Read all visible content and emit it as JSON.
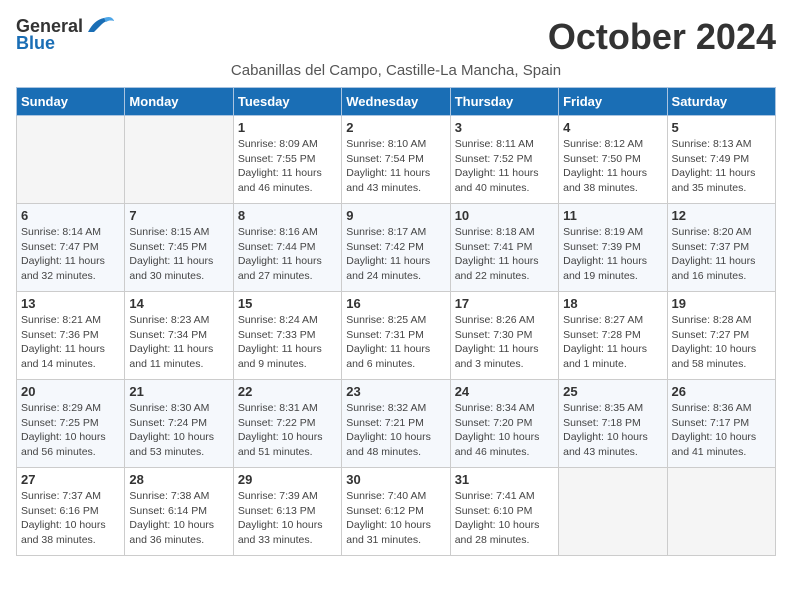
{
  "header": {
    "logo_general": "General",
    "logo_blue": "Blue",
    "month_title": "October 2024",
    "location": "Cabanillas del Campo, Castille-La Mancha, Spain"
  },
  "weekdays": [
    "Sunday",
    "Monday",
    "Tuesday",
    "Wednesday",
    "Thursday",
    "Friday",
    "Saturday"
  ],
  "weeks": [
    [
      {
        "day": "",
        "sunrise": "",
        "sunset": "",
        "daylight": ""
      },
      {
        "day": "",
        "sunrise": "",
        "sunset": "",
        "daylight": ""
      },
      {
        "day": "1",
        "sunrise": "Sunrise: 8:09 AM",
        "sunset": "Sunset: 7:55 PM",
        "daylight": "Daylight: 11 hours and 46 minutes."
      },
      {
        "day": "2",
        "sunrise": "Sunrise: 8:10 AM",
        "sunset": "Sunset: 7:54 PM",
        "daylight": "Daylight: 11 hours and 43 minutes."
      },
      {
        "day": "3",
        "sunrise": "Sunrise: 8:11 AM",
        "sunset": "Sunset: 7:52 PM",
        "daylight": "Daylight: 11 hours and 40 minutes."
      },
      {
        "day": "4",
        "sunrise": "Sunrise: 8:12 AM",
        "sunset": "Sunset: 7:50 PM",
        "daylight": "Daylight: 11 hours and 38 minutes."
      },
      {
        "day": "5",
        "sunrise": "Sunrise: 8:13 AM",
        "sunset": "Sunset: 7:49 PM",
        "daylight": "Daylight: 11 hours and 35 minutes."
      }
    ],
    [
      {
        "day": "6",
        "sunrise": "Sunrise: 8:14 AM",
        "sunset": "Sunset: 7:47 PM",
        "daylight": "Daylight: 11 hours and 32 minutes."
      },
      {
        "day": "7",
        "sunrise": "Sunrise: 8:15 AM",
        "sunset": "Sunset: 7:45 PM",
        "daylight": "Daylight: 11 hours and 30 minutes."
      },
      {
        "day": "8",
        "sunrise": "Sunrise: 8:16 AM",
        "sunset": "Sunset: 7:44 PM",
        "daylight": "Daylight: 11 hours and 27 minutes."
      },
      {
        "day": "9",
        "sunrise": "Sunrise: 8:17 AM",
        "sunset": "Sunset: 7:42 PM",
        "daylight": "Daylight: 11 hours and 24 minutes."
      },
      {
        "day": "10",
        "sunrise": "Sunrise: 8:18 AM",
        "sunset": "Sunset: 7:41 PM",
        "daylight": "Daylight: 11 hours and 22 minutes."
      },
      {
        "day": "11",
        "sunrise": "Sunrise: 8:19 AM",
        "sunset": "Sunset: 7:39 PM",
        "daylight": "Daylight: 11 hours and 19 minutes."
      },
      {
        "day": "12",
        "sunrise": "Sunrise: 8:20 AM",
        "sunset": "Sunset: 7:37 PM",
        "daylight": "Daylight: 11 hours and 16 minutes."
      }
    ],
    [
      {
        "day": "13",
        "sunrise": "Sunrise: 8:21 AM",
        "sunset": "Sunset: 7:36 PM",
        "daylight": "Daylight: 11 hours and 14 minutes."
      },
      {
        "day": "14",
        "sunrise": "Sunrise: 8:23 AM",
        "sunset": "Sunset: 7:34 PM",
        "daylight": "Daylight: 11 hours and 11 minutes."
      },
      {
        "day": "15",
        "sunrise": "Sunrise: 8:24 AM",
        "sunset": "Sunset: 7:33 PM",
        "daylight": "Daylight: 11 hours and 9 minutes."
      },
      {
        "day": "16",
        "sunrise": "Sunrise: 8:25 AM",
        "sunset": "Sunset: 7:31 PM",
        "daylight": "Daylight: 11 hours and 6 minutes."
      },
      {
        "day": "17",
        "sunrise": "Sunrise: 8:26 AM",
        "sunset": "Sunset: 7:30 PM",
        "daylight": "Daylight: 11 hours and 3 minutes."
      },
      {
        "day": "18",
        "sunrise": "Sunrise: 8:27 AM",
        "sunset": "Sunset: 7:28 PM",
        "daylight": "Daylight: 11 hours and 1 minute."
      },
      {
        "day": "19",
        "sunrise": "Sunrise: 8:28 AM",
        "sunset": "Sunset: 7:27 PM",
        "daylight": "Daylight: 10 hours and 58 minutes."
      }
    ],
    [
      {
        "day": "20",
        "sunrise": "Sunrise: 8:29 AM",
        "sunset": "Sunset: 7:25 PM",
        "daylight": "Daylight: 10 hours and 56 minutes."
      },
      {
        "day": "21",
        "sunrise": "Sunrise: 8:30 AM",
        "sunset": "Sunset: 7:24 PM",
        "daylight": "Daylight: 10 hours and 53 minutes."
      },
      {
        "day": "22",
        "sunrise": "Sunrise: 8:31 AM",
        "sunset": "Sunset: 7:22 PM",
        "daylight": "Daylight: 10 hours and 51 minutes."
      },
      {
        "day": "23",
        "sunrise": "Sunrise: 8:32 AM",
        "sunset": "Sunset: 7:21 PM",
        "daylight": "Daylight: 10 hours and 48 minutes."
      },
      {
        "day": "24",
        "sunrise": "Sunrise: 8:34 AM",
        "sunset": "Sunset: 7:20 PM",
        "daylight": "Daylight: 10 hours and 46 minutes."
      },
      {
        "day": "25",
        "sunrise": "Sunrise: 8:35 AM",
        "sunset": "Sunset: 7:18 PM",
        "daylight": "Daylight: 10 hours and 43 minutes."
      },
      {
        "day": "26",
        "sunrise": "Sunrise: 8:36 AM",
        "sunset": "Sunset: 7:17 PM",
        "daylight": "Daylight: 10 hours and 41 minutes."
      }
    ],
    [
      {
        "day": "27",
        "sunrise": "Sunrise: 7:37 AM",
        "sunset": "Sunset: 6:16 PM",
        "daylight": "Daylight: 10 hours and 38 minutes."
      },
      {
        "day": "28",
        "sunrise": "Sunrise: 7:38 AM",
        "sunset": "Sunset: 6:14 PM",
        "daylight": "Daylight: 10 hours and 36 minutes."
      },
      {
        "day": "29",
        "sunrise": "Sunrise: 7:39 AM",
        "sunset": "Sunset: 6:13 PM",
        "daylight": "Daylight: 10 hours and 33 minutes."
      },
      {
        "day": "30",
        "sunrise": "Sunrise: 7:40 AM",
        "sunset": "Sunset: 6:12 PM",
        "daylight": "Daylight: 10 hours and 31 minutes."
      },
      {
        "day": "31",
        "sunrise": "Sunrise: 7:41 AM",
        "sunset": "Sunset: 6:10 PM",
        "daylight": "Daylight: 10 hours and 28 minutes."
      },
      {
        "day": "",
        "sunrise": "",
        "sunset": "",
        "daylight": ""
      },
      {
        "day": "",
        "sunrise": "",
        "sunset": "",
        "daylight": ""
      }
    ]
  ]
}
